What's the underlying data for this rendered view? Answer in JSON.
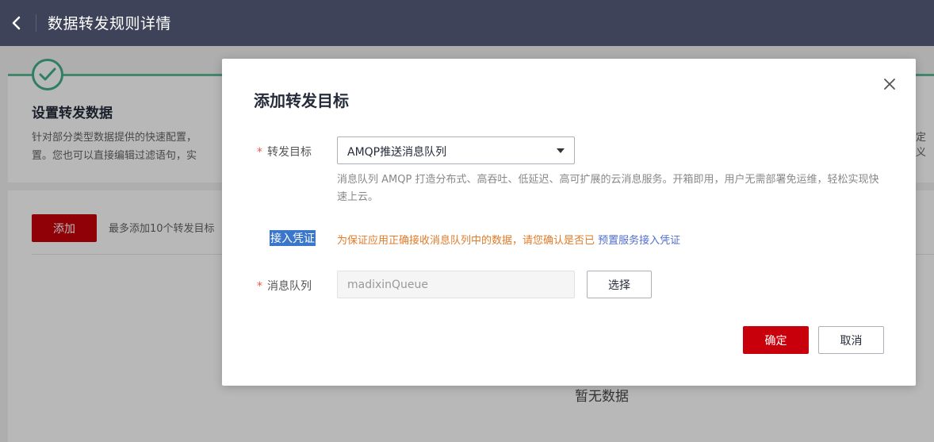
{
  "header": {
    "title": "数据转发规则详情",
    "back_icon": "chevron-left-icon"
  },
  "step": {
    "title": "设置转发数据",
    "desc_line1": "针对部分类型数据提供的快速配置，",
    "desc_line2": "置。您也可以直接编辑过滤语句，实",
    "desc_right": "定义",
    "check_icon": "check-circle-icon"
  },
  "list": {
    "add_label": "添加",
    "add_hint": "最多添加10个转发目标",
    "empty_text": "暂无数据"
  },
  "dialog": {
    "title": "添加转发目标",
    "target_label": "转发目标",
    "target_value": "AMQP推送消息队列",
    "target_desc": "消息队列 AMQP 打造分布式、高吞吐、低延迟、高可扩展的云消息服务。开箱即用，用户无需部署免运维，轻松实现快速上云。",
    "cred_label": "接入凭证",
    "cred_warning": "为保证应用正确接收消息队列中的数据，请您确认是否已",
    "cred_link": "预置服务接入凭证",
    "queue_label": "消息队列",
    "queue_value": "madixinQueue",
    "choose_label": "选择",
    "ok_label": "确定",
    "cancel_label": "取消"
  },
  "colors": {
    "brand_red": "#c7000b",
    "header_bg": "#3f4359",
    "success_green": "#43b08a",
    "warning_orange": "#e07c2a",
    "link_blue": "#526ecc"
  }
}
